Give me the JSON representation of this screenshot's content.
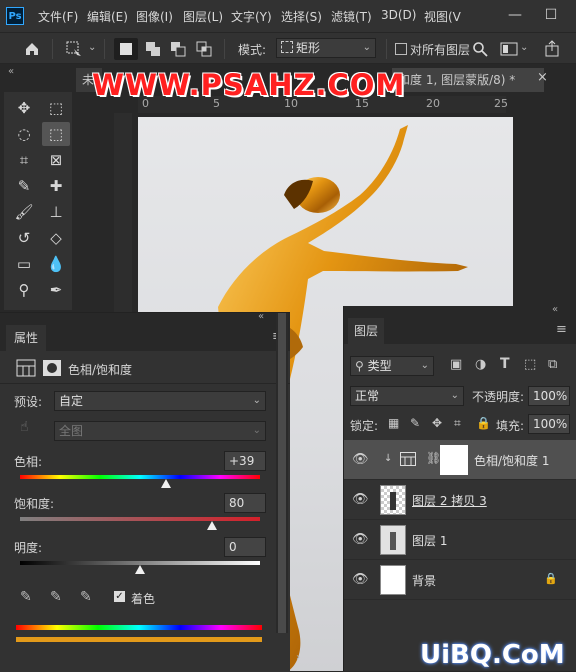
{
  "app": {
    "logo": "Ps"
  },
  "menubar": {
    "items": [
      "文件(F)",
      "编辑(E)",
      "图像(I)",
      "图层(L)",
      "文字(Y)",
      "选择(S)",
      "滤镜(T)",
      "3D(D)",
      "视图(V"
    ],
    "window_buttons": [
      "—",
      "☐"
    ]
  },
  "options_bar": {
    "mode_label": "模式:",
    "mode_value": "矩形",
    "align_label": "对所有图层"
  },
  "tabs": {
    "doc1_fragment": "未",
    "doc2_title": "和度 1, 图层蒙版/8) *",
    "close": "×"
  },
  "rulers": {
    "h_ticks": [
      "0",
      "5",
      "10",
      "15",
      "20",
      "25"
    ]
  },
  "watermark_top": "WWW.PSAHZ.COM",
  "watermark_bottom": "UiBQ.CoM",
  "properties": {
    "tab_title": "属性",
    "adjustment_title": "色相/饱和度",
    "preset_label": "预设:",
    "preset_value": "自定",
    "channel_value": "全图",
    "hue_label": "色相:",
    "hue_value": "+39",
    "hue_pos": 0.608,
    "saturation_label": "饱和度:",
    "saturation_value": "80",
    "saturation_pos": 0.8,
    "lightness_label": "明度:",
    "lightness_value": "0",
    "lightness_pos": 0.5,
    "colorize_label": "着色",
    "colorize_checked": true
  },
  "layers": {
    "tab_title": "图层",
    "filter_kind": "类型",
    "blend_mode": "正常",
    "opacity_label": "不透明度:",
    "opacity_value": "100%",
    "lock_label": "锁定:",
    "fill_label": "填充:",
    "fill_value": "100%",
    "rows": [
      {
        "name": "色相/饱和度 1",
        "visible": true,
        "selected": true
      },
      {
        "name": "图层 2 拷贝 3",
        "visible": true,
        "selected": false
      },
      {
        "name": "图层 1",
        "visible": true,
        "selected": false
      },
      {
        "name": "背景",
        "visible": true,
        "selected": false,
        "locked": true
      }
    ]
  },
  "colors": {
    "panel_bg": "#323232",
    "accent_gold": "#e39a1a",
    "watermark_red": "#ff2020"
  }
}
